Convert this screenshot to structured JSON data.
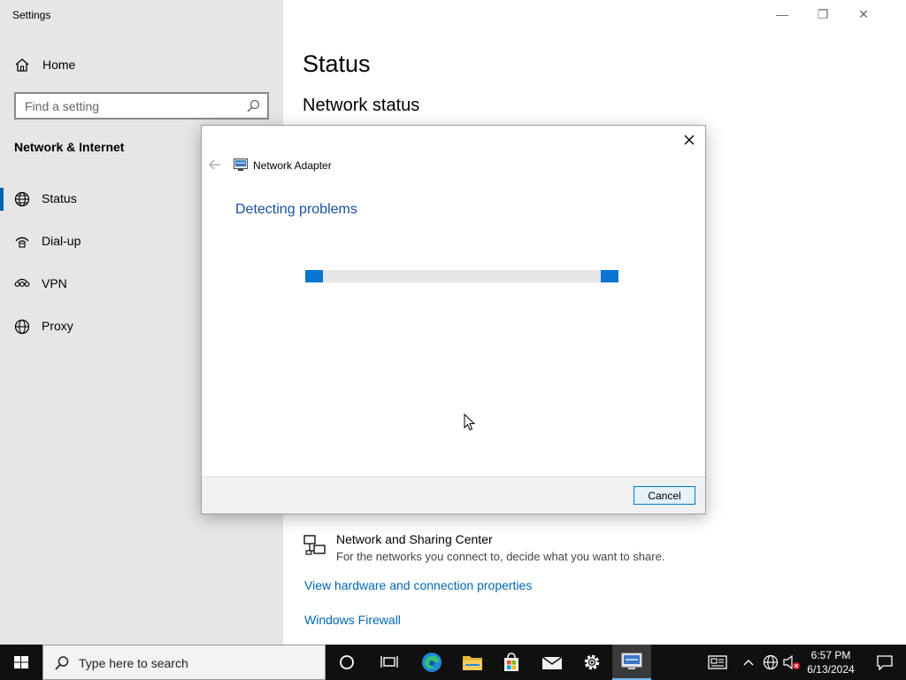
{
  "window": {
    "app_title": "Settings",
    "controls": {
      "minimize": "—",
      "restore": "❐",
      "close": "✕"
    }
  },
  "sidebar": {
    "home_label": "Home",
    "search_placeholder": "Find a setting",
    "section_title": "Network & Internet",
    "items": [
      {
        "label": "Status",
        "icon": "globe-icon",
        "active": true
      },
      {
        "label": "Dial-up",
        "icon": "dialup-icon",
        "active": false
      },
      {
        "label": "VPN",
        "icon": "vpn-icon",
        "active": false
      },
      {
        "label": "Proxy",
        "icon": "globe-icon",
        "active": false
      }
    ]
  },
  "main": {
    "title": "Status",
    "subheading": "Network status",
    "sharing_center": {
      "title": "Network and Sharing Center",
      "description": "For the networks you connect to, decide what you want to share."
    },
    "links": [
      "View hardware and connection properties",
      "Windows Firewall"
    ]
  },
  "dialog": {
    "app_name": "Network Adapter",
    "heading": "Detecting problems",
    "cancel_label": "Cancel"
  },
  "taskbar": {
    "search_placeholder": "Type here to search",
    "clock_time": "6:57 PM",
    "clock_date": "6/13/2024"
  },
  "colors": {
    "accent": "#0063b1",
    "link": "#0066b4",
    "progress": "#0a74d2",
    "dialog_heading": "#1a4fa0"
  }
}
